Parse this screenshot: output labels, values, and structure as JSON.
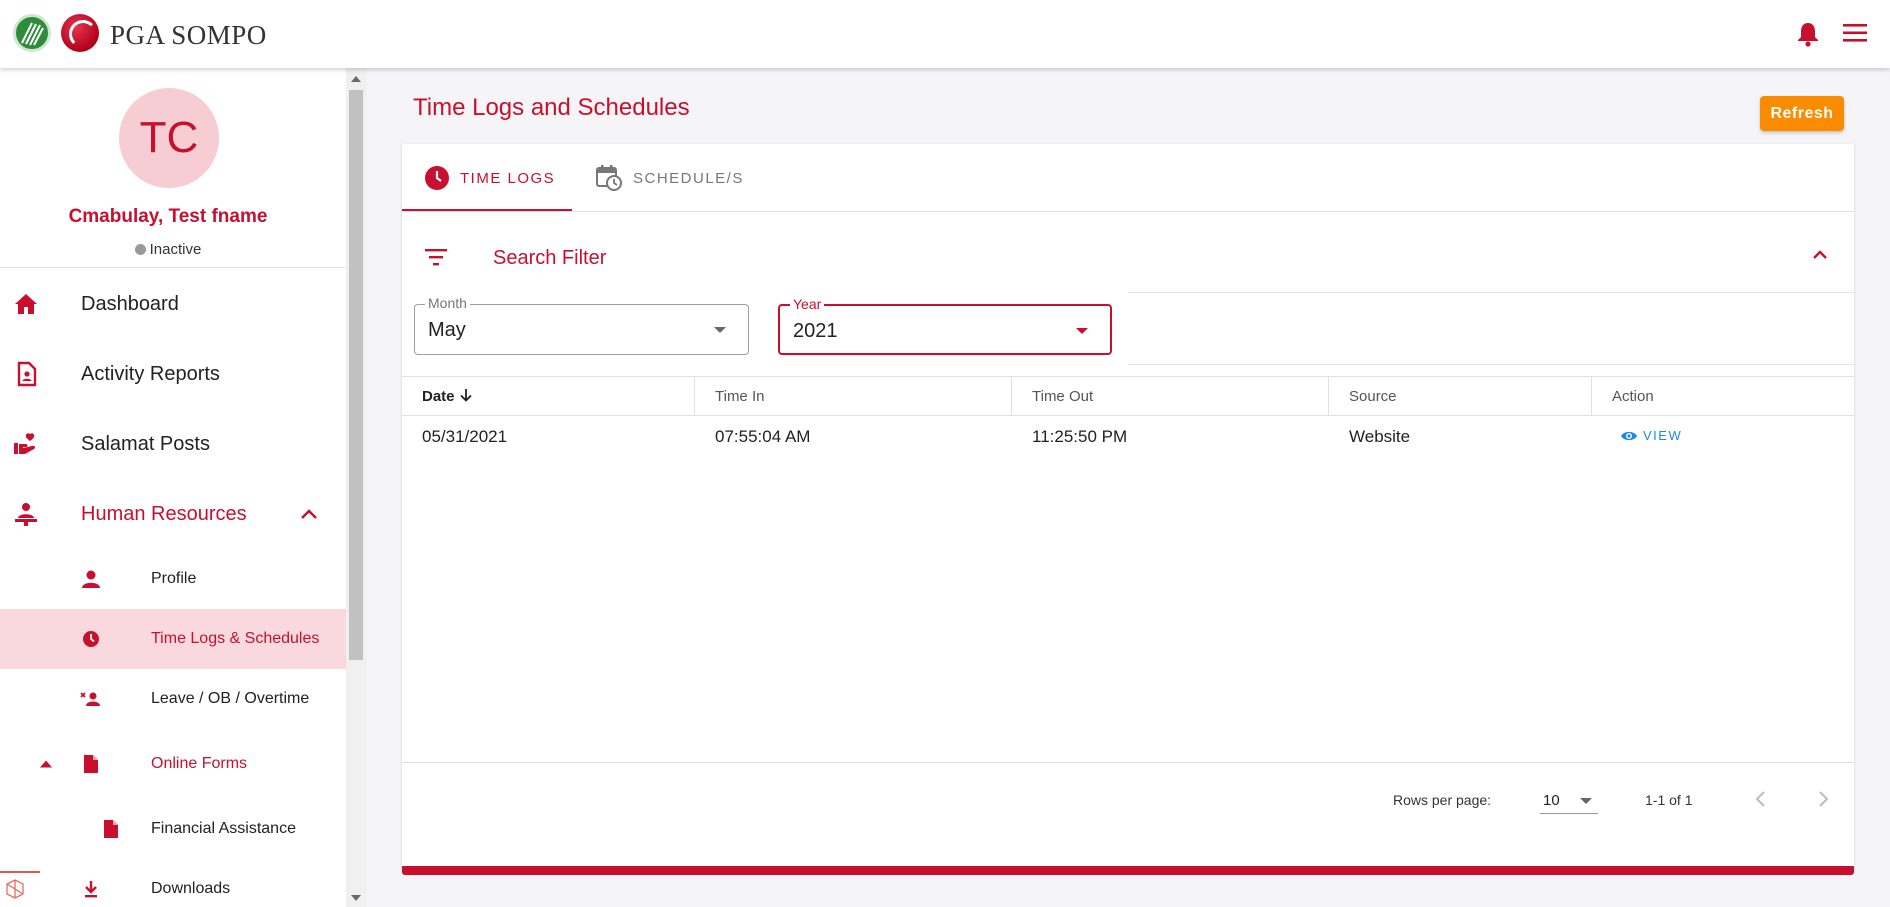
{
  "header": {
    "brand": "PGA SOMPO"
  },
  "user": {
    "initials": "TC",
    "name": "Cmabulay, Test fname",
    "status": "Inactive"
  },
  "sidebar": {
    "items": [
      {
        "label": "Dashboard",
        "icon": "home-icon"
      },
      {
        "label": "Activity Reports",
        "icon": "report-icon"
      },
      {
        "label": "Salamat Posts",
        "icon": "heart-hand-icon"
      },
      {
        "label": "Human Resources",
        "icon": "person-desk-icon"
      }
    ],
    "sub_items": [
      {
        "label": "Profile",
        "icon": "person-icon"
      },
      {
        "label": "Time Logs & Schedules",
        "icon": "clock-icon"
      },
      {
        "label": "Leave / OB / Overtime",
        "icon": "person-remove-icon"
      },
      {
        "label": "Online Forms",
        "icon": "file-icon"
      },
      {
        "label": "Financial Assistance",
        "icon": "file-icon"
      },
      {
        "label": "Downloads",
        "icon": "download-icon"
      }
    ]
  },
  "page": {
    "title": "Time Logs and Schedules",
    "refresh_label": "Refresh"
  },
  "tabs": [
    {
      "label": "TIME LOGS",
      "icon": "clock-icon"
    },
    {
      "label": "SCHEDULE/S",
      "icon": "calendar-clock-icon"
    }
  ],
  "filter": {
    "title": "Search Filter",
    "month_label": "Month",
    "month_value": "May",
    "year_label": "Year",
    "year_value": "2021"
  },
  "table": {
    "columns": [
      "Date",
      "Time In",
      "Time Out",
      "Source",
      "Action"
    ],
    "rows": [
      {
        "date": "05/31/2021",
        "time_in": "07:55:04 AM",
        "time_out": "11:25:50 PM",
        "source": "Website",
        "action": "VIEW"
      }
    ]
  },
  "pagination": {
    "rows_per_page_label": "Rows per page:",
    "rows_per_page_value": "10",
    "range": "1-1 of 1"
  },
  "colors": {
    "primary": "#c8102e",
    "accent": "#fb8c00",
    "link": "#1e88e5"
  }
}
